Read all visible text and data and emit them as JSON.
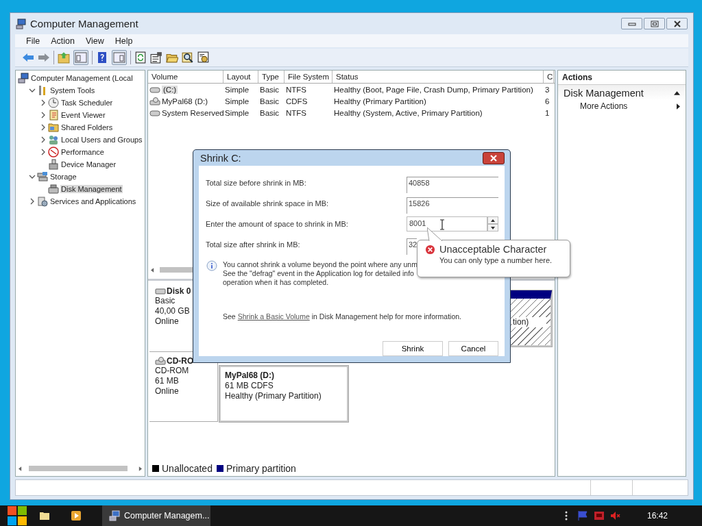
{
  "window": {
    "title": "Computer Management"
  },
  "menu": [
    "File",
    "Action",
    "View",
    "Help"
  ],
  "tree": [
    {
      "label": "Computer Management (Local",
      "selected": false,
      "children": [
        {
          "label": "System Tools",
          "expanded": true,
          "selected": false,
          "children": [
            {
              "label": "Task Scheduler",
              "expanded": false,
              "selected": false
            },
            {
              "label": "Event Viewer",
              "expanded": false,
              "selected": false
            },
            {
              "label": "Shared Folders",
              "expanded": false,
              "selected": false
            },
            {
              "label": "Local Users and Groups",
              "expanded": false,
              "selected": false
            },
            {
              "label": "Performance",
              "expanded": false,
              "selected": false
            },
            {
              "label": "Device Manager",
              "selected": false
            }
          ]
        },
        {
          "label": "Storage",
          "expanded": true,
          "selected": false,
          "children": [
            {
              "label": "Disk Management",
              "selected": true
            }
          ]
        },
        {
          "label": "Services and Applications",
          "expanded": false,
          "selected": false
        }
      ]
    }
  ],
  "volumes": {
    "columns": [
      "Volume",
      "Layout",
      "Type",
      "File System",
      "Status",
      "C"
    ],
    "rows": [
      {
        "kind": "disk",
        "selected": true,
        "cells": [
          "(C:)",
          "Simple",
          "Basic",
          "NTFS",
          "Healthy (Boot, Page File, Crash Dump, Primary Partition)",
          "3"
        ]
      },
      {
        "kind": "cd",
        "selected": false,
        "cells": [
          "MyPal68 (D:)",
          "Simple",
          "Basic",
          "CDFS",
          "Healthy (Primary Partition)",
          "6"
        ]
      },
      {
        "kind": "disk",
        "selected": false,
        "cells": [
          "System Reserved",
          "Simple",
          "Basic",
          "NTFS",
          "Healthy (System, Active, Primary Partition)",
          "1"
        ]
      }
    ]
  },
  "disks": [
    {
      "kind": "disk",
      "name": "Disk 0",
      "lines": [
        "Basic",
        "40,00 GB",
        "Online"
      ],
      "partitions": [
        {
          "lines": [
            "tion)"
          ],
          "selected": true,
          "color": "#000080"
        }
      ]
    },
    {
      "kind": "cd",
      "name": "CD-RO",
      "lines": [
        "CD-ROM",
        "61 MB",
        "Online"
      ],
      "partitions": [
        {
          "name": "MyPal68  (D:)",
          "lines": [
            "61 MB CDFS",
            "Healthy (Primary Partition)"
          ],
          "selected": false
        }
      ]
    }
  ],
  "legend": [
    {
      "label": "Unallocated",
      "color": "#000000"
    },
    {
      "label": "Primary partition",
      "color": "#000080"
    }
  ],
  "actions": {
    "title": "Actions",
    "sections": [
      {
        "label": "Disk Management",
        "expanded": true,
        "items": [
          "More Actions"
        ]
      }
    ]
  },
  "dialog": {
    "title": "Shrink C:",
    "fields": [
      {
        "label": "Total size before shrink in MB:",
        "value": "40858",
        "kind": "readonly"
      },
      {
        "label": "Size of available shrink space in MB:",
        "value": "15826",
        "kind": "readonly"
      },
      {
        "label": "Enter the amount of space to shrink in MB:",
        "value": "8001",
        "kind": "spin"
      },
      {
        "label": "Total size after shrink in MB:",
        "value": "32",
        "kind": "covered"
      }
    ],
    "info_lines": [
      "You cannot shrink a volume beyond the point where any unm",
      "See the \"defrag\" event in the Application log for detailed info",
      "operation when it has completed."
    ],
    "help": {
      "before": "See",
      "link": "Shrink a Basic Volume",
      "after": "in Disk Management help for more information."
    },
    "buttons": [
      "Shrink",
      "Cancel"
    ]
  },
  "balloon": {
    "title": "Unacceptable Character",
    "message": "You can only type a number here."
  },
  "taskbar": {
    "task": {
      "label": "Computer Managem...",
      "selected": true
    },
    "clock": "16:42"
  }
}
